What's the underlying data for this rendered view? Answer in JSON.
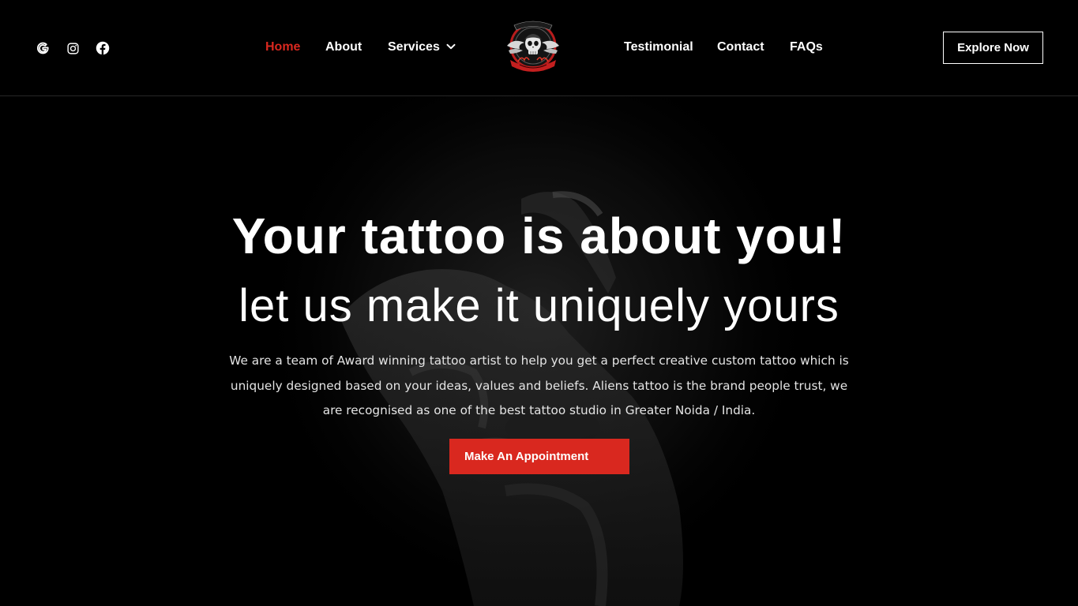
{
  "header": {
    "social": [
      {
        "icon": "google-icon"
      },
      {
        "icon": "instagram-icon"
      },
      {
        "icon": "facebook-icon"
      }
    ],
    "nav_left": [
      {
        "label": "Home",
        "active": true
      },
      {
        "label": "About",
        "active": false
      },
      {
        "label": "Services",
        "active": false,
        "has_dropdown": true
      }
    ],
    "logo_icon": "skull-wings-logo",
    "nav_right": [
      {
        "label": "Testimonial"
      },
      {
        "label": "Contact"
      },
      {
        "label": "FAQs"
      }
    ],
    "explore_label": "Explore Now"
  },
  "hero": {
    "headline": "Your tattoo is about you!",
    "subheadline": "let us make it uniquely yours",
    "intro": "We are a team of Award winning tattoo artist to help you get a perfect creative custom tattoo which is uniquely designed based on your ideas, values and beliefs. Aliens tattoo is the brand people trust, we are recognised as one of the best tattoo studio in Greater Noida / India.",
    "cta_label": "Make An Appointment"
  },
  "colors": {
    "accent": "#d9281f",
    "background": "#000000",
    "text": "#ffffff"
  }
}
